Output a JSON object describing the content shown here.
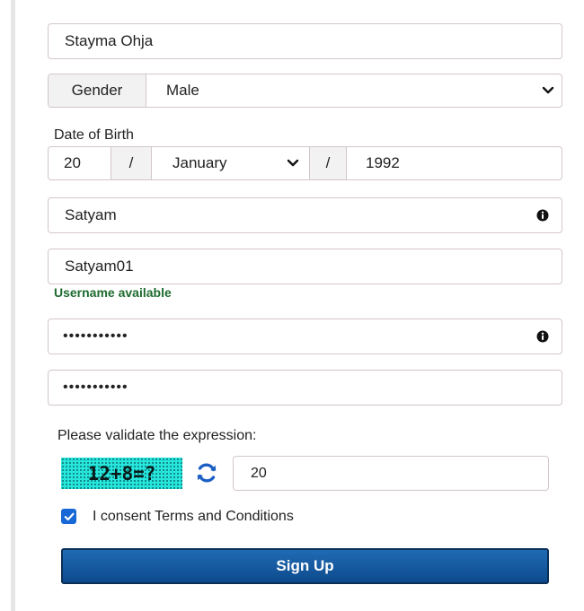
{
  "form": {
    "full_name": "Stayma Ohja",
    "gender": {
      "label": "Gender",
      "value": "Male"
    },
    "dob": {
      "label": "Date of Birth",
      "day": "20",
      "separator": "/",
      "month": "January",
      "year": "1992"
    },
    "first_name": "Satyam",
    "username": "Satyam01",
    "username_status": "Username available",
    "password_mask": "•••••••••••",
    "confirm_password_mask": "•••••••••••",
    "captcha": {
      "label": "Please validate the expression:",
      "expression": "12+8=?",
      "answer": "20"
    },
    "consent": {
      "label": "I consent Terms and Conditions",
      "checked": true
    },
    "submit_label": "Sign Up"
  },
  "icons": {
    "info": "info-circle-icon",
    "chevron": "chevron-down-icon",
    "refresh": "refresh-icon",
    "check": "check-icon"
  },
  "colors": {
    "username_available": "#1e6b2f",
    "button": "#1f6bb4",
    "checkbox": "#1768d6",
    "captcha_bg": "#27e6dd"
  }
}
